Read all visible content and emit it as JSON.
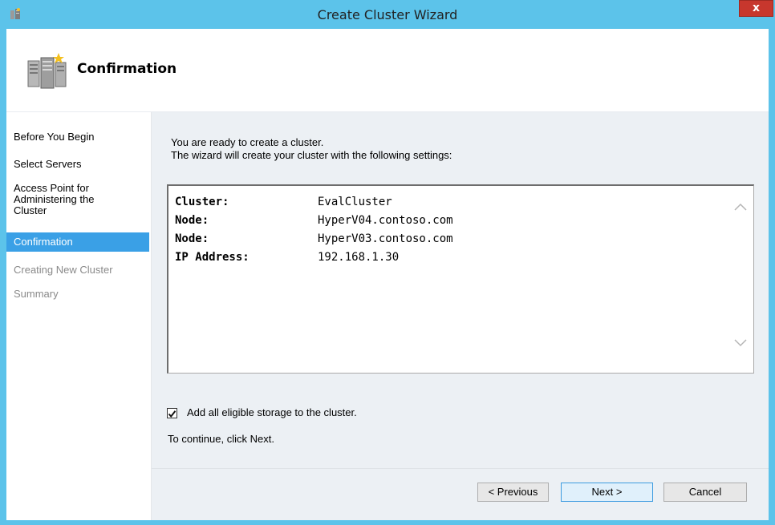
{
  "window": {
    "title": "Create Cluster Wizard",
    "close_label": "x",
    "accent_color": "#5cc3ea"
  },
  "header": {
    "title": "Confirmation",
    "icon": "cluster-servers-icon"
  },
  "nav": {
    "items": [
      {
        "label": "Before You Begin",
        "state": "normal"
      },
      {
        "label": "Select Servers",
        "state": "normal"
      },
      {
        "label": "Access Point for Administering the Cluster",
        "lines": [
          "Access Point for",
          "Administering the",
          "Cluster"
        ],
        "state": "normal"
      },
      {
        "label": "Confirmation",
        "state": "selected"
      },
      {
        "label": "Creating New Cluster",
        "state": "disabled"
      },
      {
        "label": "Summary",
        "state": "disabled"
      }
    ]
  },
  "main": {
    "intro_line1": "You are ready to create a cluster.",
    "intro_line2": "The wizard will create your cluster with the following settings:",
    "settings": [
      {
        "key": "Cluster:",
        "value": "EvalCluster"
      },
      {
        "key": "Node:",
        "value": "HyperV04.contoso.com"
      },
      {
        "key": "Node:",
        "value": "HyperV03.contoso.com"
      },
      {
        "key": "IP Address:",
        "value": "192.168.1.30"
      }
    ],
    "storage_checkbox": {
      "label": "Add all eligible storage to the cluster.",
      "checked": true
    },
    "continue_text": "To continue, click Next."
  },
  "footer": {
    "previous_label": "< Previous",
    "next_label": "Next >",
    "cancel_label": "Cancel"
  }
}
